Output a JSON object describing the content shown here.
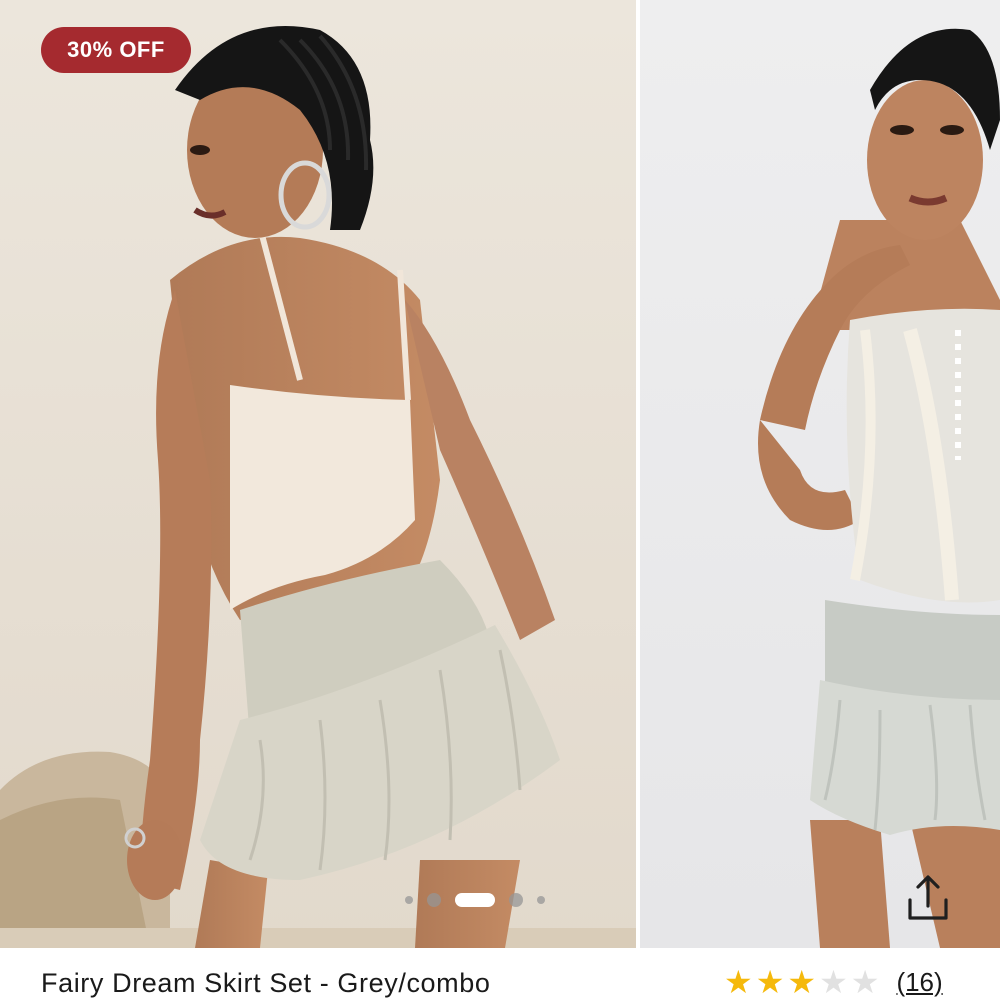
{
  "badge": {
    "discount_label": "30% OFF",
    "color": "#a52a2f"
  },
  "gallery": {
    "images": [
      {
        "alt": "model in back view wearing mesh cami and ruffled skirt"
      },
      {
        "alt": "model in front view wearing mesh corset top and ruffled skirt"
      }
    ],
    "dots": {
      "count": 5,
      "active_index": 2
    }
  },
  "share": {
    "icon": "share-icon"
  },
  "product": {
    "title": "Fairy Dream Skirt Set - Grey/combo",
    "rating": {
      "value": 3,
      "max": 5,
      "filled_color": "#f5b90c",
      "empty_color": "#e1e1e1"
    },
    "review_count_label": "(16)"
  }
}
